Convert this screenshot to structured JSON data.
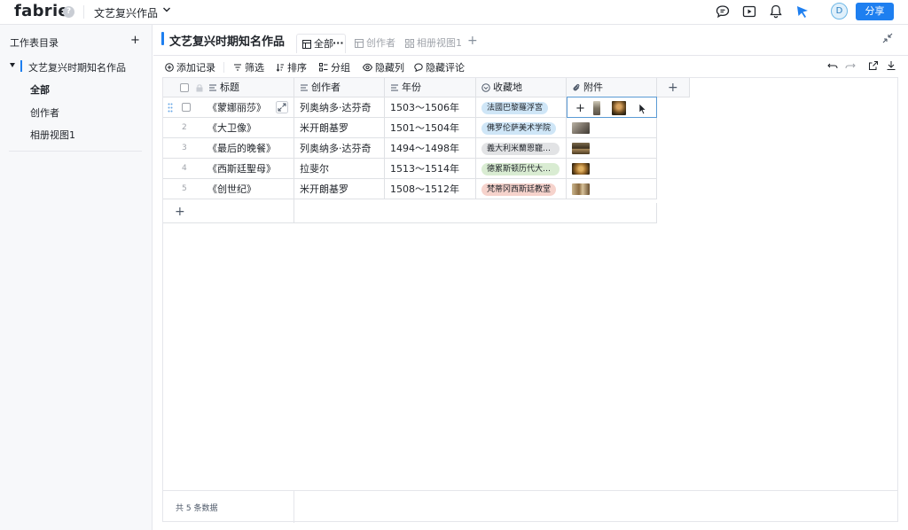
{
  "app": {
    "logo": "fabrie",
    "help": "?",
    "workspace": "文艺复兴作品",
    "share_label": "分享",
    "avatar_initial": "D"
  },
  "top_icons": [
    "chat-icon",
    "video-icon",
    "bell-icon",
    "cursor-icon"
  ],
  "sidebar": {
    "title": "工作表目录",
    "add": "+",
    "table_name": "文艺复兴时期知名作品",
    "views": [
      {
        "label": "全部"
      },
      {
        "label": "创作者"
      },
      {
        "label": "相册视图1"
      }
    ]
  },
  "main": {
    "title": "文艺复兴时期知名作品",
    "tabs": [
      {
        "label": "全部",
        "more": "···",
        "active": true
      },
      {
        "label": "创作者",
        "active": false
      },
      {
        "label": "相册视图1",
        "active": false
      }
    ],
    "tab_add": "+"
  },
  "toolbar": {
    "add_record": "添加记录",
    "filter": "筛选",
    "sort": "排序",
    "group": "分组",
    "hide_fields": "隐藏列",
    "hide_comments": "隐藏评论"
  },
  "grid": {
    "columns": [
      {
        "label": "标题",
        "icon": "text-icon"
      },
      {
        "label": "创作者",
        "icon": "text-icon"
      },
      {
        "label": "年份",
        "icon": "text-icon"
      },
      {
        "label": "收藏地",
        "icon": "select-icon"
      },
      {
        "label": "附件",
        "icon": "attachment-icon"
      }
    ],
    "add_column": "+",
    "rows": [
      {
        "num": "1",
        "title": "《蒙娜丽莎》",
        "creator": "列奥纳多·达芬奇",
        "year": "1503～1506年",
        "location": "法國巴黎羅浮宮",
        "tag_bg": "#cfe6f7",
        "tag_fg": "#1f2329"
      },
      {
        "num": "2",
        "title": "《大卫像》",
        "creator": "米开朗基罗",
        "year": "1501～1504年",
        "location": "佛罗伦萨美术学院",
        "tag_bg": "#cfe6f7",
        "tag_fg": "#1f2329"
      },
      {
        "num": "3",
        "title": "《最后的晚餐》",
        "creator": "列奥纳多·达芬奇",
        "year": "1494～1498年",
        "location": "義大利米蘭恩寵聖母",
        "tag_bg": "#e2e3e5",
        "tag_fg": "#1f2329"
      },
      {
        "num": "4",
        "title": "《西斯廷聖母》",
        "creator": "拉斐尔",
        "year": "1513～1514年",
        "location": "德累斯顿历代大师…",
        "tag_bg": "#d9ecd2",
        "tag_fg": "#1f2329"
      },
      {
        "num": "5",
        "title": "《创世纪》",
        "creator": "米开朗基罗",
        "year": "1508～1512年",
        "location": "梵蒂冈西斯廷教堂",
        "tag_bg": "#f6d3cc",
        "tag_fg": "#1f2329"
      }
    ],
    "add_row": "+",
    "attachment_add": "+",
    "footer": "共 5 条数据"
  }
}
